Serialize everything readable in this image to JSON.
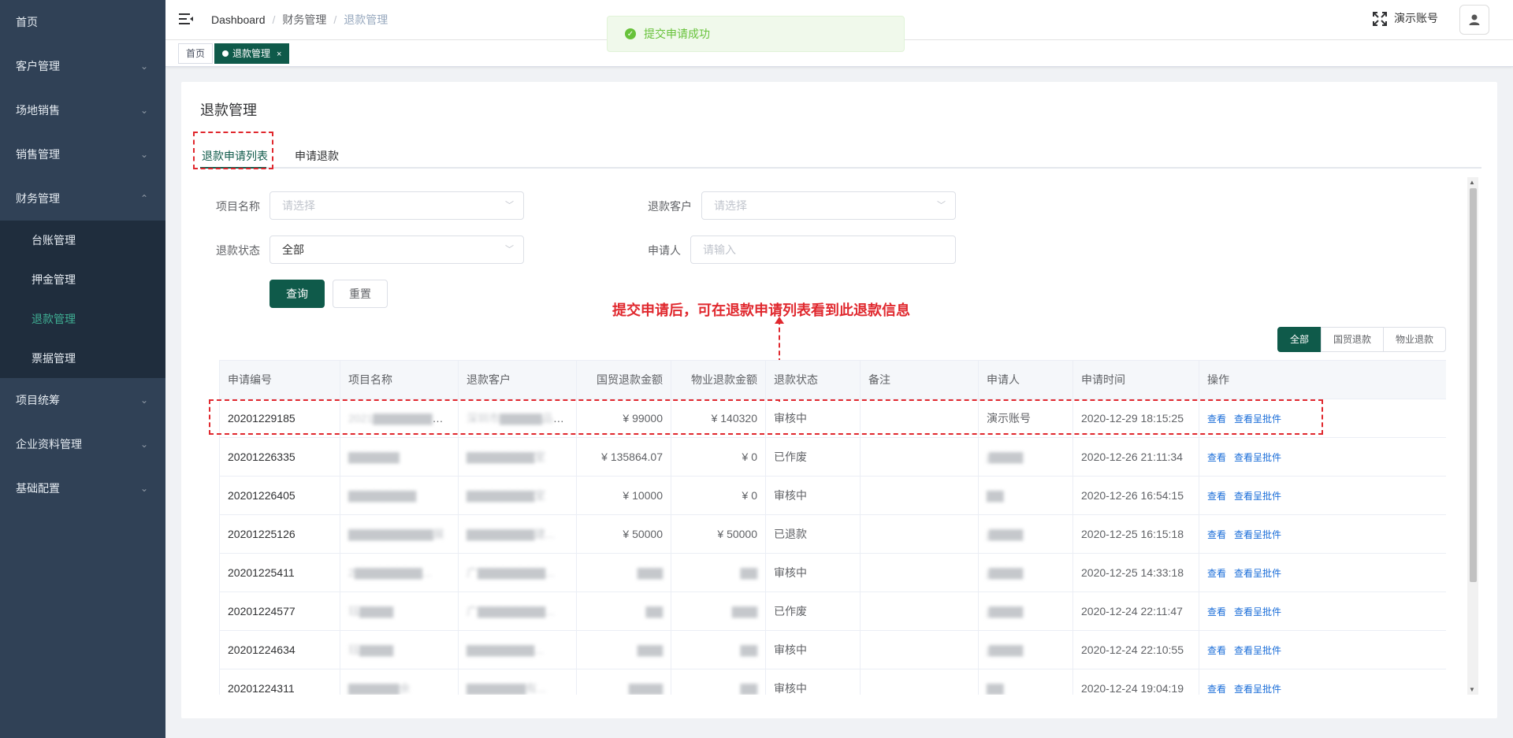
{
  "sidebar": {
    "items": [
      {
        "label": "首页",
        "has_arrow": false
      },
      {
        "label": "客户管理",
        "has_arrow": true
      },
      {
        "label": "场地销售",
        "has_arrow": true
      },
      {
        "label": "销售管理",
        "has_arrow": true
      },
      {
        "label": "财务管理",
        "has_arrow": true,
        "expanded": true
      }
    ],
    "sub_items": [
      "台账管理",
      "押金管理",
      "退款管理",
      "票据管理"
    ],
    "active_sub": "退款管理",
    "items_after": [
      "项目统筹",
      "企业资料管理",
      "基础配置"
    ],
    "arrow_glyph": "⌄",
    "arrow_up_glyph": "⌃"
  },
  "navbar": {
    "breadcrumb": [
      "Dashboard",
      "财务管理",
      "退款管理"
    ],
    "breadcrumb_sep": "/",
    "user_name": "演示账号"
  },
  "tags": [
    {
      "label": "首页",
      "active": false
    },
    {
      "label": "退款管理",
      "active": true,
      "close": "×"
    }
  ],
  "message": {
    "text": "提交申请成功",
    "icon": "success-check",
    "color": "#67c23a"
  },
  "page": {
    "title": "退款管理",
    "tabs": [
      "退款申请列表",
      "申请退款"
    ],
    "active_tab": "退款申请列表"
  },
  "filters": {
    "project_label": "项目名称",
    "project_placeholder": "请选择",
    "customer_label": "退款客户",
    "customer_placeholder": "请选择",
    "status_label": "退款状态",
    "status_value": "全部",
    "applicant_label": "申请人",
    "applicant_placeholder": "请输入",
    "query_button": "查询",
    "reset_button": "重置"
  },
  "annotation": "提交申请后，可在退款申请列表看到此退款信息",
  "segment": [
    "全部",
    "国贸退款",
    "物业退款"
  ],
  "colors": {
    "primary": "#0f5a4a",
    "annotation": "#e0282e",
    "sidebar": "#304156",
    "link": "#1a6dd8"
  },
  "table": {
    "headers": [
      "申请编号",
      "项目名称",
      "退款客户",
      "国贸退款金额",
      "物业退款金额",
      "退款状态",
      "备注",
      "申请人",
      "申请时间",
      "操作"
    ],
    "actions": [
      "查看",
      "查看呈批件"
    ],
    "rows": [
      {
        "id": "20201229185",
        "project": "2021▇▇▇▇▇▇▇食...",
        "customer": "深圳市▇▇▇▇▇品有...",
        "gm_amount": "¥ 99000",
        "wy_amount": "¥ 140320",
        "status": "审核中",
        "remark": "",
        "applicant": "演示账号",
        "time": "2020-12-29 18:15:25"
      },
      {
        "id": "20201226335",
        "project": "▇▇▇▇▇▇",
        "customer": "▇▇▇▇▇▇▇▇室",
        "gm_amount": "¥ 135864.07",
        "wy_amount": "¥ 0",
        "status": "已作废",
        "remark": "",
        "applicant": "j▇▇▇▇",
        "time": "2020-12-26 21:11:34"
      },
      {
        "id": "20201226405",
        "project": "▇▇▇▇▇▇▇▇",
        "customer": "▇▇▇▇▇▇▇▇室",
        "gm_amount": "¥ 10000",
        "wy_amount": "¥ 0",
        "status": "审核中",
        "remark": "",
        "applicant": "▇▇",
        "time": "2020-12-26 16:54:15"
      },
      {
        "id": "20201225126",
        "project": "▇▇▇▇▇▇▇▇▇▇展",
        "customer": "▇▇▇▇▇▇▇▇建...",
        "gm_amount": "¥ 50000",
        "wy_amount": "¥ 50000",
        "status": "已退款",
        "remark": "",
        "applicant": "j▇▇▇▇",
        "time": "2020-12-25 16:15:18"
      },
      {
        "id": "20201225411",
        "project": "2▇▇▇▇▇▇▇▇...",
        "customer": "广▇▇▇▇▇▇▇▇...",
        "gm_amount": "▇▇▇",
        "wy_amount": "▇▇",
        "status": "审核中",
        "remark": "",
        "applicant": "j▇▇▇▇",
        "time": "2020-12-25 14:33:18"
      },
      {
        "id": "20201224577",
        "project": "珏▇▇▇▇",
        "customer": "广▇▇▇▇▇▇▇▇...",
        "gm_amount": "▇▇",
        "wy_amount": "▇▇▇",
        "status": "已作废",
        "remark": "",
        "applicant": "j▇▇▇▇",
        "time": "2020-12-24 22:11:47"
      },
      {
        "id": "20201224634",
        "project": "珏▇▇▇▇",
        "customer": "▇▇▇▇▇▇▇▇...",
        "gm_amount": "▇▇▇",
        "wy_amount": "▇▇",
        "status": "审核中",
        "remark": "",
        "applicant": "j▇▇▇▇",
        "time": "2020-12-24 22:10:55"
      },
      {
        "id": "20201224311",
        "project": "▇▇▇▇▇▇余",
        "customer": "▇▇▇▇▇▇▇有...",
        "gm_amount": "▇▇▇▇",
        "wy_amount": "▇▇",
        "status": "审核中",
        "remark": "",
        "applicant": "▇▇",
        "time": "2020-12-24 19:04:19"
      }
    ]
  }
}
